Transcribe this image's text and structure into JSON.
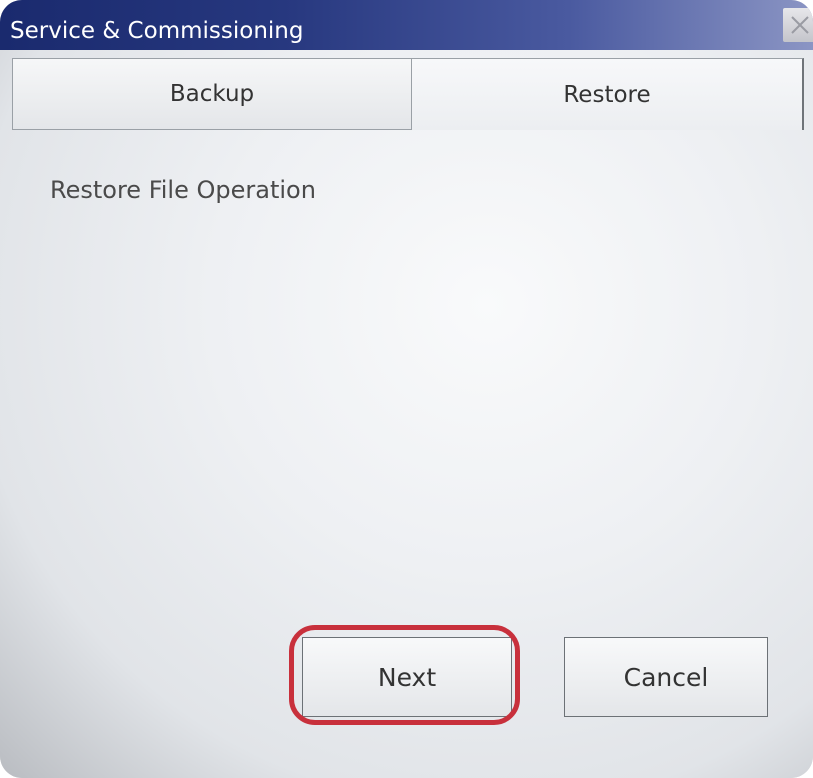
{
  "window": {
    "title": "Service & Commissioning"
  },
  "tabs": [
    {
      "label": "Backup",
      "selected": false
    },
    {
      "label": "Restore",
      "selected": true
    }
  ],
  "content": {
    "operation_label": "Restore File Operation"
  },
  "buttons": {
    "next_label": "Next",
    "cancel_label": "Cancel"
  },
  "icons": {
    "close": "close-icon"
  },
  "colors": {
    "titlebar": "#1a2a6e",
    "highlight": "#c8303c",
    "text": "#333333"
  }
}
